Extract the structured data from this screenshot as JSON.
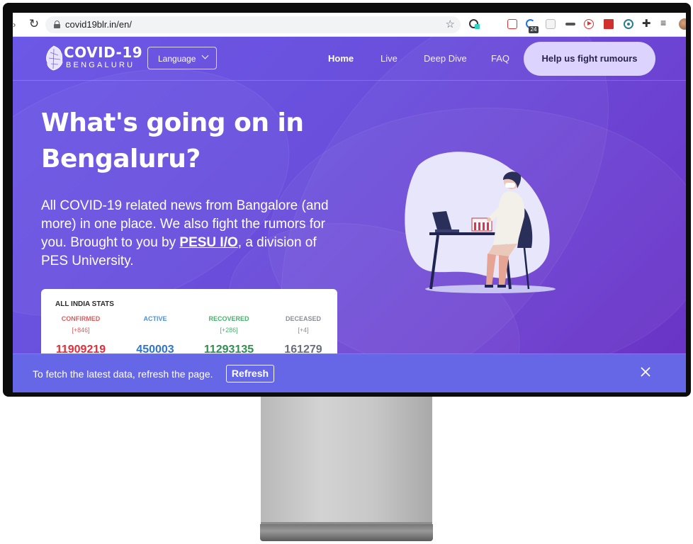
{
  "browser": {
    "url": "covid19blr.in/en/",
    "extension_badge": "24"
  },
  "site": {
    "logo_title": "COVID-19",
    "logo_subtitle": "BENGALURU",
    "language_label": "Language",
    "nav": [
      "Home",
      "Live",
      "Deep Dive",
      "FAQ"
    ],
    "cta_label": "Help us fight rumours",
    "headline_line1": "What's going on in",
    "headline_line2": "Bengaluru?",
    "intro_prefix": "All COVID-19 related news from Bangalore (and more) in one place. We also fight the rumors for you. Brought to you by ",
    "intro_link": "PESU I/O",
    "intro_suffix": ", a division of PES University."
  },
  "stats": {
    "title": "ALL INDIA STATS",
    "columns": [
      {
        "label": "CONFIRMED",
        "delta": "[+846]",
        "value": "11909219",
        "color": "#e02d39"
      },
      {
        "label": "ACTIVE",
        "delta": "",
        "value": "450003",
        "color": "#2f75c8"
      },
      {
        "label": "RECOVERED",
        "delta": "[+286]",
        "value": "11293135",
        "color": "#2f8f4e"
      },
      {
        "label": "DECEASED",
        "delta": "[+4]",
        "value": "161279",
        "color": "#6b6f7a"
      }
    ]
  },
  "refresh_bar": {
    "message": "To fetch the latest data, refresh the page.",
    "button_label": "Refresh"
  }
}
